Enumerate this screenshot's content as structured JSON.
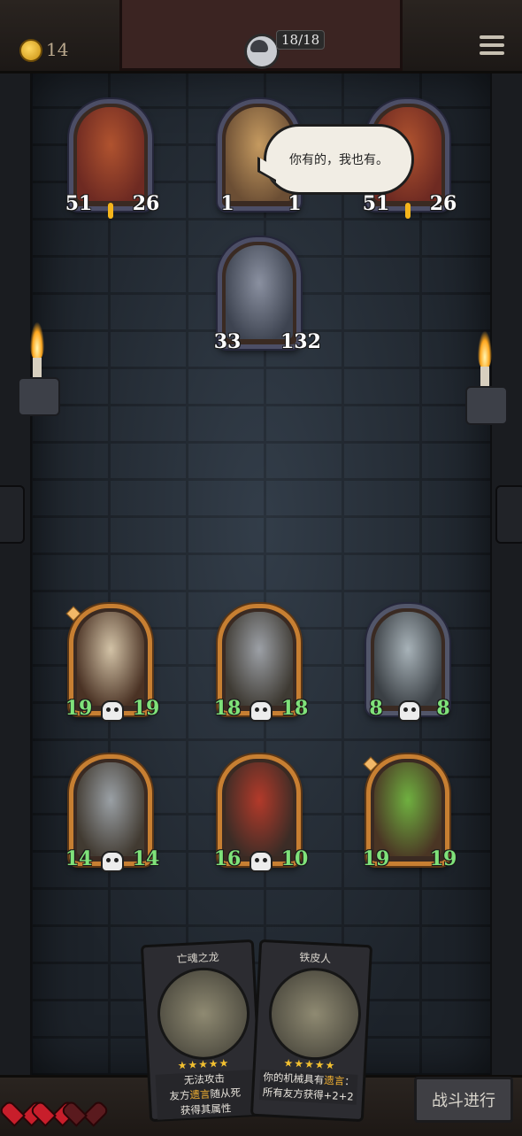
{
  "top_bar": {
    "coins": "14",
    "hero_hp": "18/18"
  },
  "enemy_board": [
    {
      "name": "beast-left",
      "attack": "51",
      "health": "26",
      "colors": [
        "#6e2a22",
        "#b0532f"
      ]
    },
    {
      "name": "fox-adventurer",
      "attack": "1",
      "health": "1",
      "colors": [
        "#6b4e34",
        "#c59a60"
      ]
    },
    {
      "name": "beast-right",
      "attack": "51",
      "health": "26",
      "colors": [
        "#6e2a22",
        "#b0532f"
      ]
    },
    {
      "name": "wolf-guard",
      "attack": "33",
      "health": "132",
      "colors": [
        "#3d4350",
        "#8a90a0"
      ]
    }
  ],
  "speech_bubble": "你有的，我也有。",
  "player_board": [
    {
      "name": "bullet-zeppelin",
      "attack": "19",
      "health": "19",
      "colors": [
        "#4a3224",
        "#d2c2a6"
      ]
    },
    {
      "name": "tin-man",
      "attack": "18",
      "health": "18",
      "colors": [
        "#3e3a33",
        "#9ca0a6"
      ]
    },
    {
      "name": "steam-worker",
      "attack": "8",
      "health": "8",
      "colors": [
        "#3a3f44",
        "#a7b2b8"
      ]
    },
    {
      "name": "robot-sidekick",
      "attack": "14",
      "health": "14",
      "colors": [
        "#413a31",
        "#9aa0a5"
      ]
    },
    {
      "name": "red-mech",
      "attack": "16",
      "health": "10",
      "colors": [
        "#3b2c26",
        "#b33a2a"
      ]
    },
    {
      "name": "frog-monster",
      "attack": "19",
      "health": "19",
      "colors": [
        "#4a3524",
        "#6fb040"
      ]
    }
  ],
  "hand": [
    {
      "title": "亡魂之龙",
      "stars": "★★★★★",
      "line1": "无法攻击",
      "line2_pre": "友方",
      "line2_kw": "遗言",
      "line2_post": "随从死",
      "line3": "获得其属性"
    },
    {
      "title": "铁皮人",
      "stars": "★★★★★",
      "line1_pre": "你的机械具有",
      "line1_kw": "遗言",
      "line1_post": "：",
      "line2": "所有友方获得+2+2"
    }
  ],
  "lives": {
    "full": 2,
    "total": 3
  },
  "end_turn_label": "战斗进行"
}
